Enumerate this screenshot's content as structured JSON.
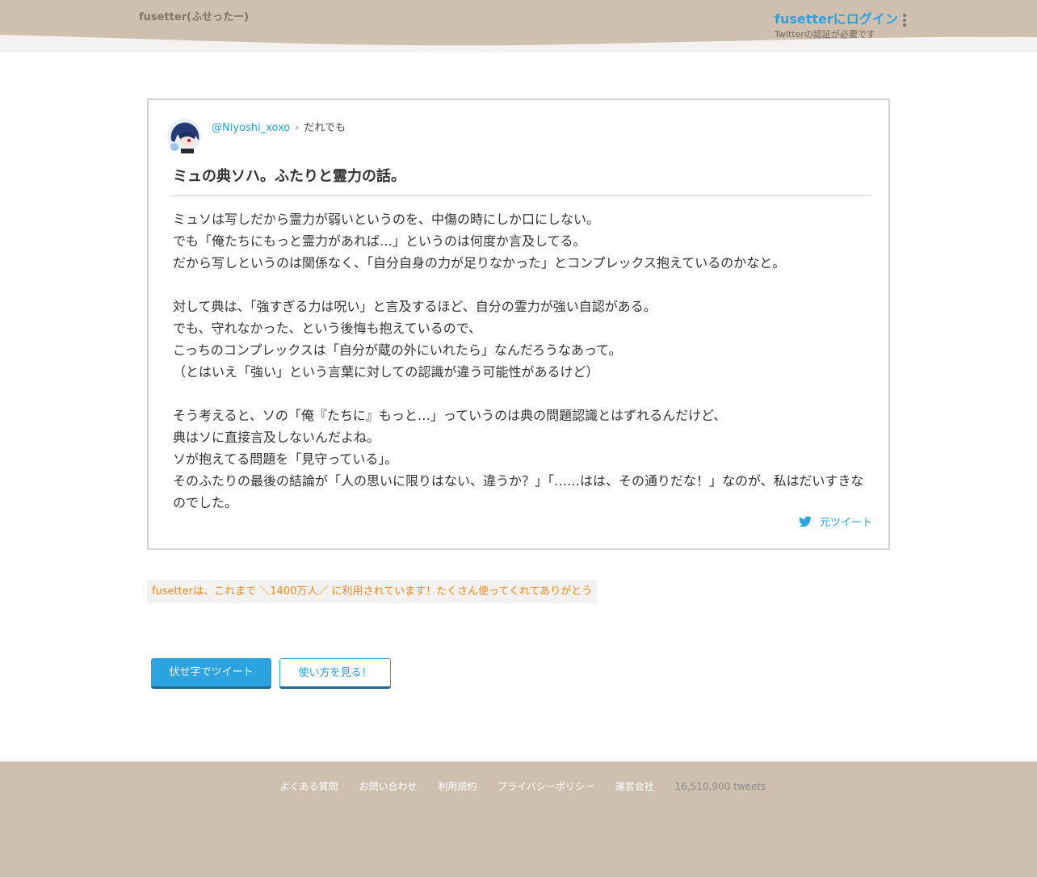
{
  "header": {
    "brand": "fusetter(ふせったー)",
    "login_label": "fusetterにログイン",
    "login_note": "Twitterの認証が必要です"
  },
  "post": {
    "username": "@Niyoshi_xoxo",
    "separator": "›",
    "audience": "だれでも",
    "title": "ミュの典ソハ。ふたりと霊力の話。",
    "paragraphs": [
      "ミュソは写しだから霊力が弱いというのを、中傷の時にしか口にしない。",
      "でも「俺たちにもっと霊力があれば…」というのは何度か言及してる。",
      "だから写しというのは関係なく、「自分自身の力が足りなかった」とコンプレックス抱えているのかなと。",
      "",
      "対して典は、「強すぎる力は呪い」と言及するほど、自分の霊力が強い自認がある。",
      "でも、守れなかった、という後悔も抱えているので、",
      "こっちのコンプレックスは「自分が蔵の外にいれたら」なんだろうなあって。",
      "（とはいえ「強い」という言葉に対しての認識が違う可能性があるけど）",
      "",
      "そう考えると、ソの「俺『たちに』もっと…」っていうのは典の問題認識とはずれるんだけど、",
      "典はソに直接言及しないんだよね。",
      "ソが抱えてる問題を「見守っている」。",
      "そのふたりの最後の結論が「人の思いに限りはない、違うか？」「……はは、その通りだな！」なのが、私はだいすきなのでした。"
    ],
    "original_tweet_label": "元ツイート"
  },
  "notice": "fusetterは、これまで ＼1400万人／ に利用されています！たくさん使ってくれてありがとう",
  "buttons": {
    "tweet_label": "伏せ字でツイート",
    "howto_label": "使い方を見る！"
  },
  "footer": {
    "links": [
      "よくある質問",
      "お問い合わせ",
      "利用規約",
      "プライバシーポリシー",
      "運営会社"
    ],
    "tweet_count": "16,510,900 tweets"
  },
  "colors": {
    "header_band": "#cfbfae",
    "link_blue": "#2aa3e0",
    "notice_orange": "#f08a20",
    "button_shadow": "#1b6a93"
  },
  "icons": {
    "more": "more-vertical-icon",
    "original_tweet": "twitter-bird-icon",
    "avatar": "avatar-image"
  }
}
